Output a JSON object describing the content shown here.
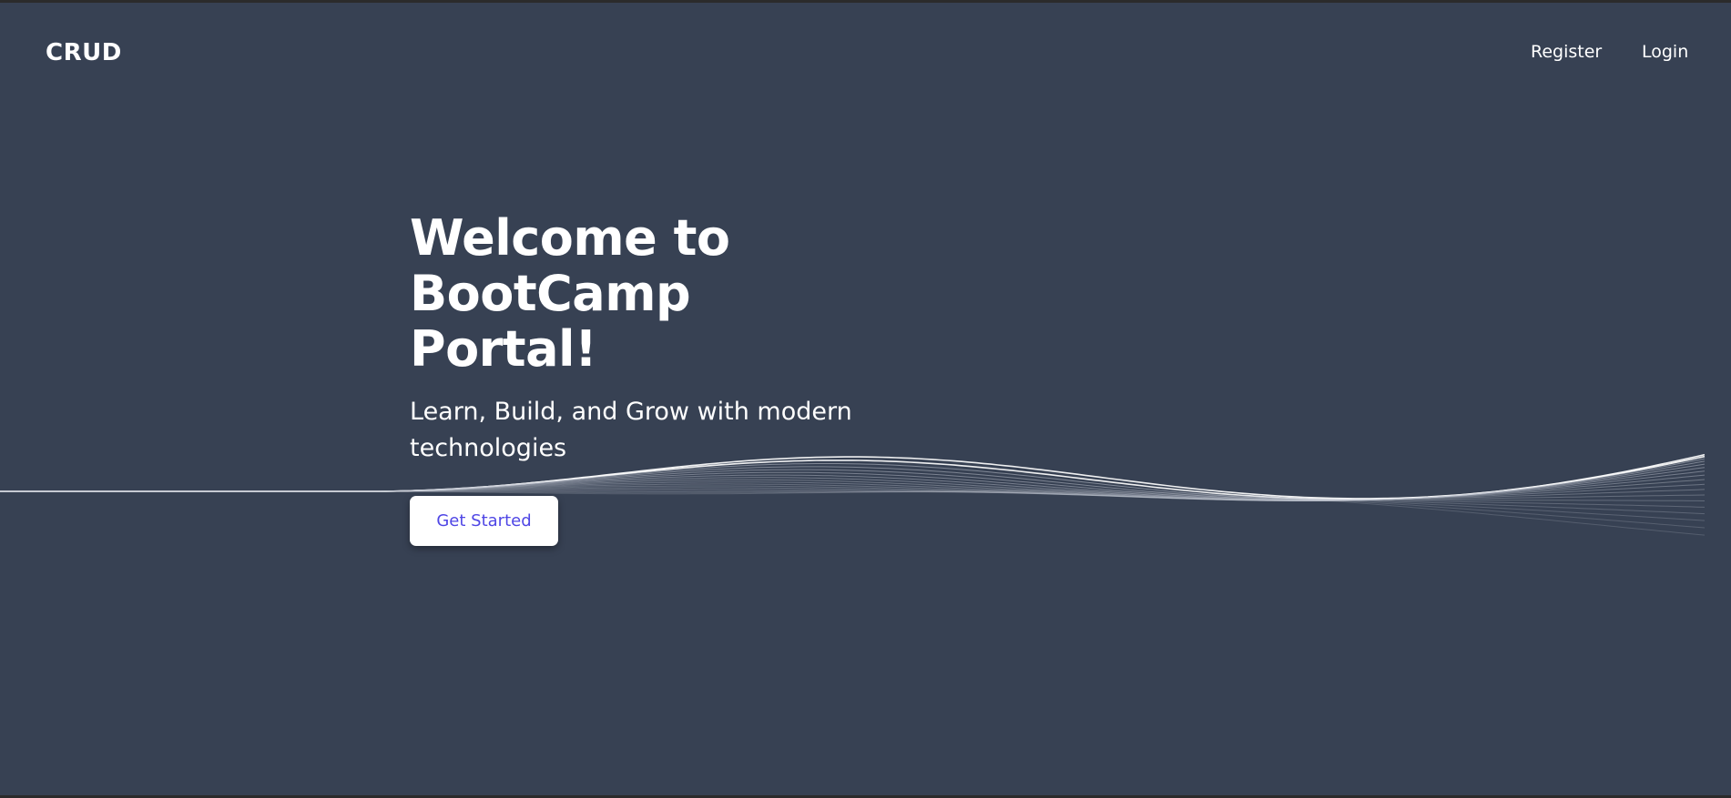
{
  "nav": {
    "brand": "CRUD",
    "links": [
      {
        "label": "Register"
      },
      {
        "label": "Login"
      }
    ]
  },
  "hero": {
    "title_lines": [
      "Welcome to",
      "BootCamp",
      "Portal!"
    ],
    "subtitle": "Learn, Build, and Grow with modern technologies",
    "cta_label": "Get Started"
  },
  "colors": {
    "background": "#374153",
    "text": "#ffffff",
    "button_bg": "#ffffff",
    "button_text": "#4f46e5"
  }
}
